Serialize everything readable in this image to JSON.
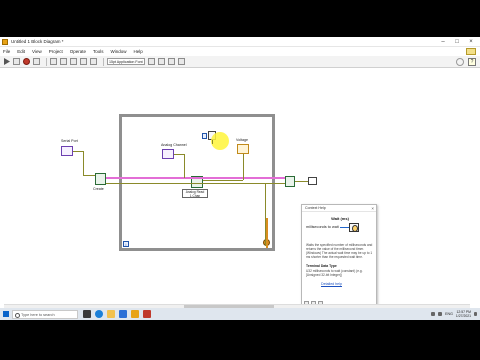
{
  "window": {
    "title": "Untitled 1 Block Diagram *",
    "controls": [
      "–",
      "□",
      "×"
    ]
  },
  "menu": [
    "File",
    "Edit",
    "View",
    "Project",
    "Operate",
    "Tools",
    "Window",
    "Help"
  ],
  "toolbar": {
    "font_select": "15pt Application Font"
  },
  "diagram": {
    "serial_port_label": "Serial Port",
    "analog_channel_label": "Analog Channel",
    "voltage_label": "Voltage",
    "analog_read_label": "Analog Read\n1 Chan",
    "left_func_label": "Create",
    "iteration_terminal": "i"
  },
  "context_help": {
    "window_title": "Context Help",
    "function_name": "Wait (ms)",
    "terminal_label": "milliseconds to wait",
    "description": "Waits the specified number of milliseconds and returns the value of the millisecond timer. (Windows) The actual wait time may be up to 1 ms shorter than the requested wait time.",
    "terminal_data_title": "Terminal Data Type",
    "terminal_data_text": "U32 milliseconds to wait (constant)  (e.g. [Unsigned 32-bit Integer])",
    "detailed_help": "Detailed help"
  },
  "taskbar": {
    "search_placeholder": "Type here to search",
    "tray_lang": "ENG",
    "time": "12:57 PM",
    "date": "1/27/2021"
  },
  "colors": {
    "loop_border": "#8f8f8f",
    "refnum_wire": "#e36ed6",
    "error_wire": "#8a8a2a",
    "bool_wire": "#d88e20",
    "cursor_highlight": "#fff43a"
  }
}
